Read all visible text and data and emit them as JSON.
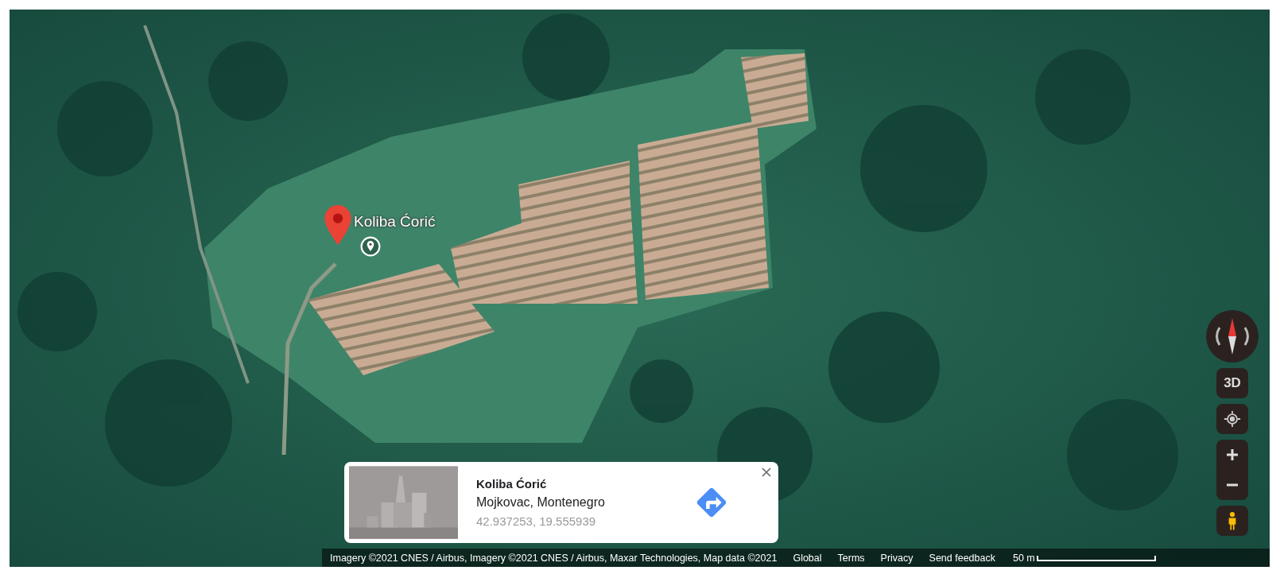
{
  "map": {
    "place_label": "Koliba Ćorić"
  },
  "info_card": {
    "title": "Koliba Ćorić",
    "subtitle": "Mojkovac, Montenegro",
    "coordinates": "42.937253, 19.555939"
  },
  "controls": {
    "tilt_button": "3D"
  },
  "footer": {
    "attribution": "Imagery ©2021 CNES / Airbus, Imagery ©2021 CNES / Airbus, Maxar Technologies, Map data ©2021",
    "links": [
      "Global",
      "Terms",
      "Privacy",
      "Send feedback"
    ],
    "scale": "50 m"
  }
}
